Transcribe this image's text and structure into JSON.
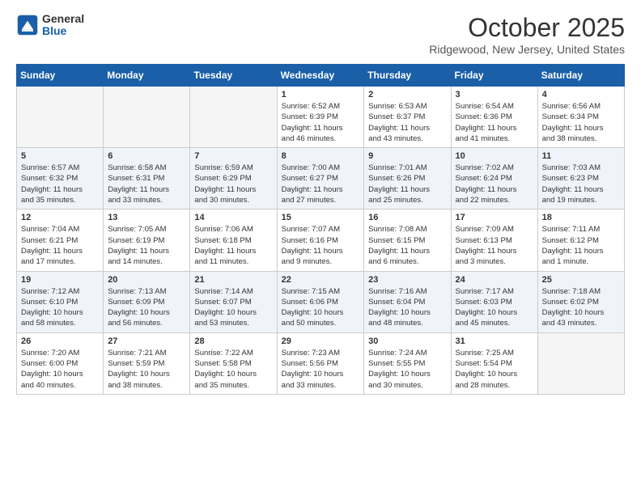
{
  "header": {
    "logo_general": "General",
    "logo_blue": "Blue",
    "month_title": "October 2025",
    "location": "Ridgewood, New Jersey, United States"
  },
  "days_of_week": [
    "Sunday",
    "Monday",
    "Tuesday",
    "Wednesday",
    "Thursday",
    "Friday",
    "Saturday"
  ],
  "weeks": [
    [
      {
        "day": "",
        "info": ""
      },
      {
        "day": "",
        "info": ""
      },
      {
        "day": "",
        "info": ""
      },
      {
        "day": "1",
        "info": "Sunrise: 6:52 AM\nSunset: 6:39 PM\nDaylight: 11 hours\nand 46 minutes."
      },
      {
        "day": "2",
        "info": "Sunrise: 6:53 AM\nSunset: 6:37 PM\nDaylight: 11 hours\nand 43 minutes."
      },
      {
        "day": "3",
        "info": "Sunrise: 6:54 AM\nSunset: 6:36 PM\nDaylight: 11 hours\nand 41 minutes."
      },
      {
        "day": "4",
        "info": "Sunrise: 6:56 AM\nSunset: 6:34 PM\nDaylight: 11 hours\nand 38 minutes."
      }
    ],
    [
      {
        "day": "5",
        "info": "Sunrise: 6:57 AM\nSunset: 6:32 PM\nDaylight: 11 hours\nand 35 minutes."
      },
      {
        "day": "6",
        "info": "Sunrise: 6:58 AM\nSunset: 6:31 PM\nDaylight: 11 hours\nand 33 minutes."
      },
      {
        "day": "7",
        "info": "Sunrise: 6:59 AM\nSunset: 6:29 PM\nDaylight: 11 hours\nand 30 minutes."
      },
      {
        "day": "8",
        "info": "Sunrise: 7:00 AM\nSunset: 6:27 PM\nDaylight: 11 hours\nand 27 minutes."
      },
      {
        "day": "9",
        "info": "Sunrise: 7:01 AM\nSunset: 6:26 PM\nDaylight: 11 hours\nand 25 minutes."
      },
      {
        "day": "10",
        "info": "Sunrise: 7:02 AM\nSunset: 6:24 PM\nDaylight: 11 hours\nand 22 minutes."
      },
      {
        "day": "11",
        "info": "Sunrise: 7:03 AM\nSunset: 6:23 PM\nDaylight: 11 hours\nand 19 minutes."
      }
    ],
    [
      {
        "day": "12",
        "info": "Sunrise: 7:04 AM\nSunset: 6:21 PM\nDaylight: 11 hours\nand 17 minutes."
      },
      {
        "day": "13",
        "info": "Sunrise: 7:05 AM\nSunset: 6:19 PM\nDaylight: 11 hours\nand 14 minutes."
      },
      {
        "day": "14",
        "info": "Sunrise: 7:06 AM\nSunset: 6:18 PM\nDaylight: 11 hours\nand 11 minutes."
      },
      {
        "day": "15",
        "info": "Sunrise: 7:07 AM\nSunset: 6:16 PM\nDaylight: 11 hours\nand 9 minutes."
      },
      {
        "day": "16",
        "info": "Sunrise: 7:08 AM\nSunset: 6:15 PM\nDaylight: 11 hours\nand 6 minutes."
      },
      {
        "day": "17",
        "info": "Sunrise: 7:09 AM\nSunset: 6:13 PM\nDaylight: 11 hours\nand 3 minutes."
      },
      {
        "day": "18",
        "info": "Sunrise: 7:11 AM\nSunset: 6:12 PM\nDaylight: 11 hours\nand 1 minute."
      }
    ],
    [
      {
        "day": "19",
        "info": "Sunrise: 7:12 AM\nSunset: 6:10 PM\nDaylight: 10 hours\nand 58 minutes."
      },
      {
        "day": "20",
        "info": "Sunrise: 7:13 AM\nSunset: 6:09 PM\nDaylight: 10 hours\nand 56 minutes."
      },
      {
        "day": "21",
        "info": "Sunrise: 7:14 AM\nSunset: 6:07 PM\nDaylight: 10 hours\nand 53 minutes."
      },
      {
        "day": "22",
        "info": "Sunrise: 7:15 AM\nSunset: 6:06 PM\nDaylight: 10 hours\nand 50 minutes."
      },
      {
        "day": "23",
        "info": "Sunrise: 7:16 AM\nSunset: 6:04 PM\nDaylight: 10 hours\nand 48 minutes."
      },
      {
        "day": "24",
        "info": "Sunrise: 7:17 AM\nSunset: 6:03 PM\nDaylight: 10 hours\nand 45 minutes."
      },
      {
        "day": "25",
        "info": "Sunrise: 7:18 AM\nSunset: 6:02 PM\nDaylight: 10 hours\nand 43 minutes."
      }
    ],
    [
      {
        "day": "26",
        "info": "Sunrise: 7:20 AM\nSunset: 6:00 PM\nDaylight: 10 hours\nand 40 minutes."
      },
      {
        "day": "27",
        "info": "Sunrise: 7:21 AM\nSunset: 5:59 PM\nDaylight: 10 hours\nand 38 minutes."
      },
      {
        "day": "28",
        "info": "Sunrise: 7:22 AM\nSunset: 5:58 PM\nDaylight: 10 hours\nand 35 minutes."
      },
      {
        "day": "29",
        "info": "Sunrise: 7:23 AM\nSunset: 5:56 PM\nDaylight: 10 hours\nand 33 minutes."
      },
      {
        "day": "30",
        "info": "Sunrise: 7:24 AM\nSunset: 5:55 PM\nDaylight: 10 hours\nand 30 minutes."
      },
      {
        "day": "31",
        "info": "Sunrise: 7:25 AM\nSunset: 5:54 PM\nDaylight: 10 hours\nand 28 minutes."
      },
      {
        "day": "",
        "info": ""
      }
    ]
  ]
}
